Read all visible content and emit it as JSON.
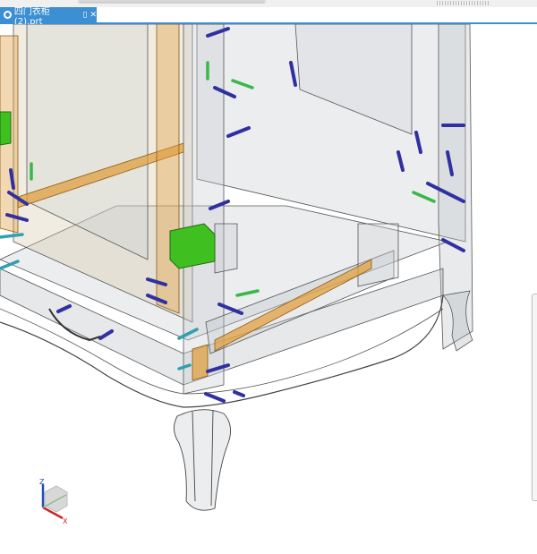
{
  "tab": {
    "title": "四门衣柜 (2).prt",
    "icon": "part-file-icon",
    "pin_icon": "pin-icon",
    "close_icon": "close-icon"
  },
  "triad": {
    "z_label": "Z",
    "x_label": "X"
  },
  "colors": {
    "accent": "#3c8fd2",
    "rail": "#e0a040",
    "bolt": "#4848c8",
    "pin": "#38b848",
    "block": "#40c020"
  }
}
